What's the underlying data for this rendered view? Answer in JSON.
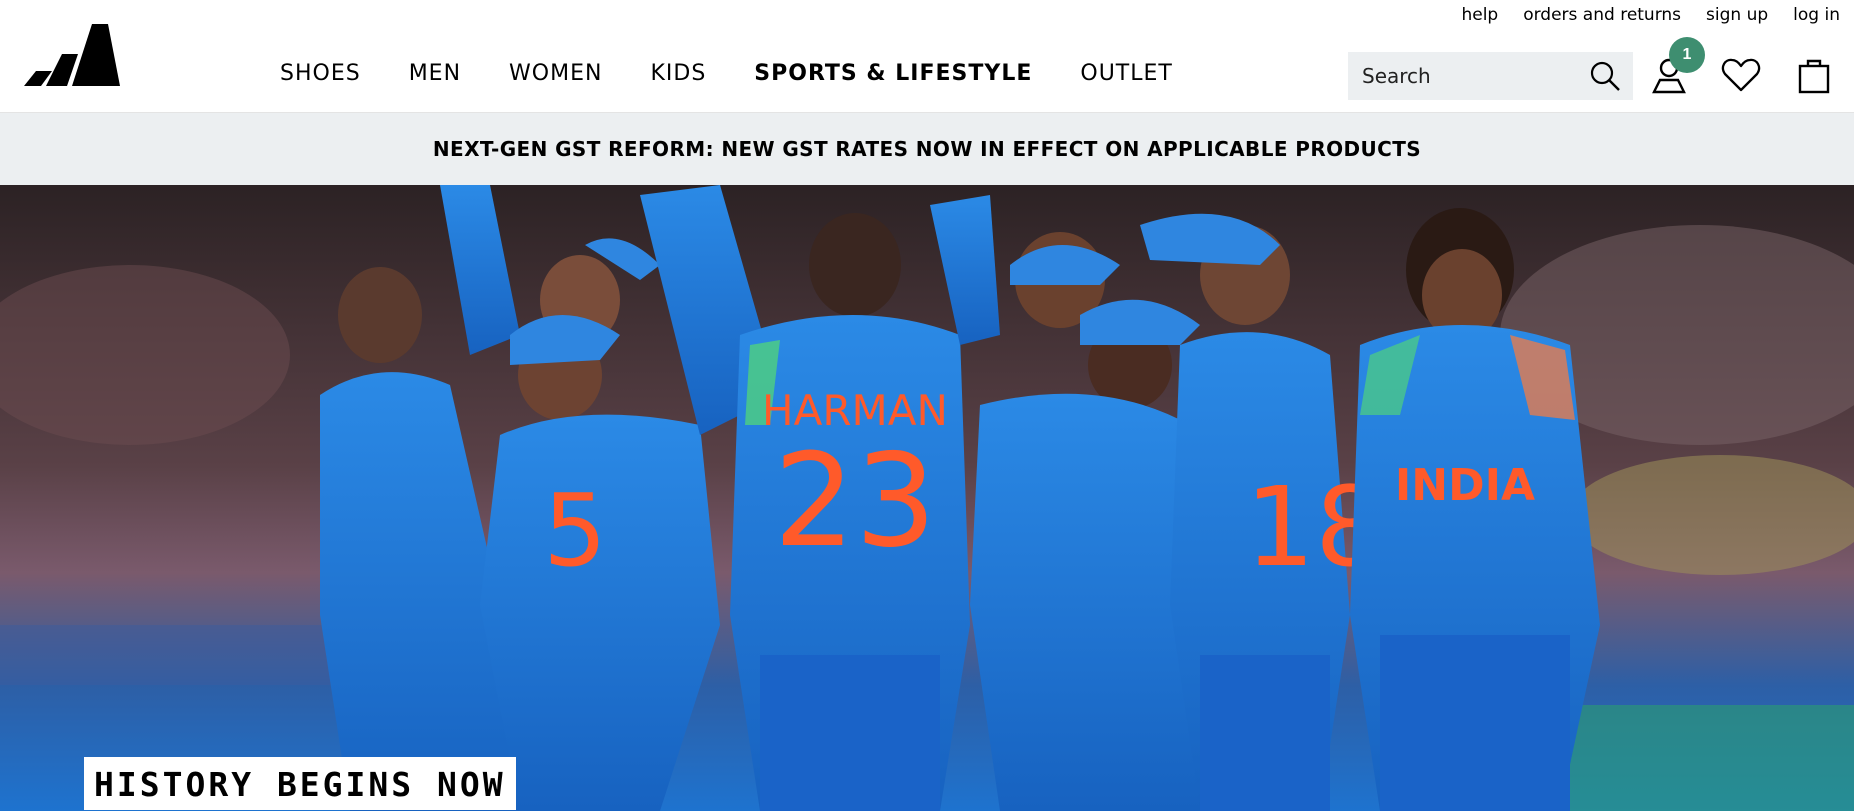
{
  "utility_links": [
    "help",
    "orders and returns",
    "sign up",
    "log in"
  ],
  "nav": {
    "items": [
      {
        "label": "SHOES",
        "bold": false
      },
      {
        "label": "MEN",
        "bold": false
      },
      {
        "label": "WOMEN",
        "bold": false
      },
      {
        "label": "KIDS",
        "bold": false
      },
      {
        "label": "SPORTS & LIFESTYLE",
        "bold": true
      },
      {
        "label": "OUTLET",
        "bold": false
      }
    ]
  },
  "search": {
    "placeholder": "Search"
  },
  "account": {
    "badge_count": "1"
  },
  "icons": {
    "logo": "adidas-logo",
    "search": "search-icon",
    "account": "user-icon",
    "wishlist": "heart-icon",
    "bag": "shopping-bag-icon"
  },
  "promo": {
    "text": "NEXT-GEN GST REFORM: NEW GST RATES NOW IN EFFECT ON APPLICABLE PRODUCTS"
  },
  "hero": {
    "tagline": "HISTORY BEGINS NOW",
    "jersey_texts": [
      "HARMAN",
      "23",
      "INDIA",
      "18",
      "5"
    ]
  },
  "colors": {
    "badge": "#3e8e70",
    "promo_bg": "#eceff1",
    "jersey_blue": "#1f7ad6",
    "jersey_number": "#ff5a2a"
  }
}
